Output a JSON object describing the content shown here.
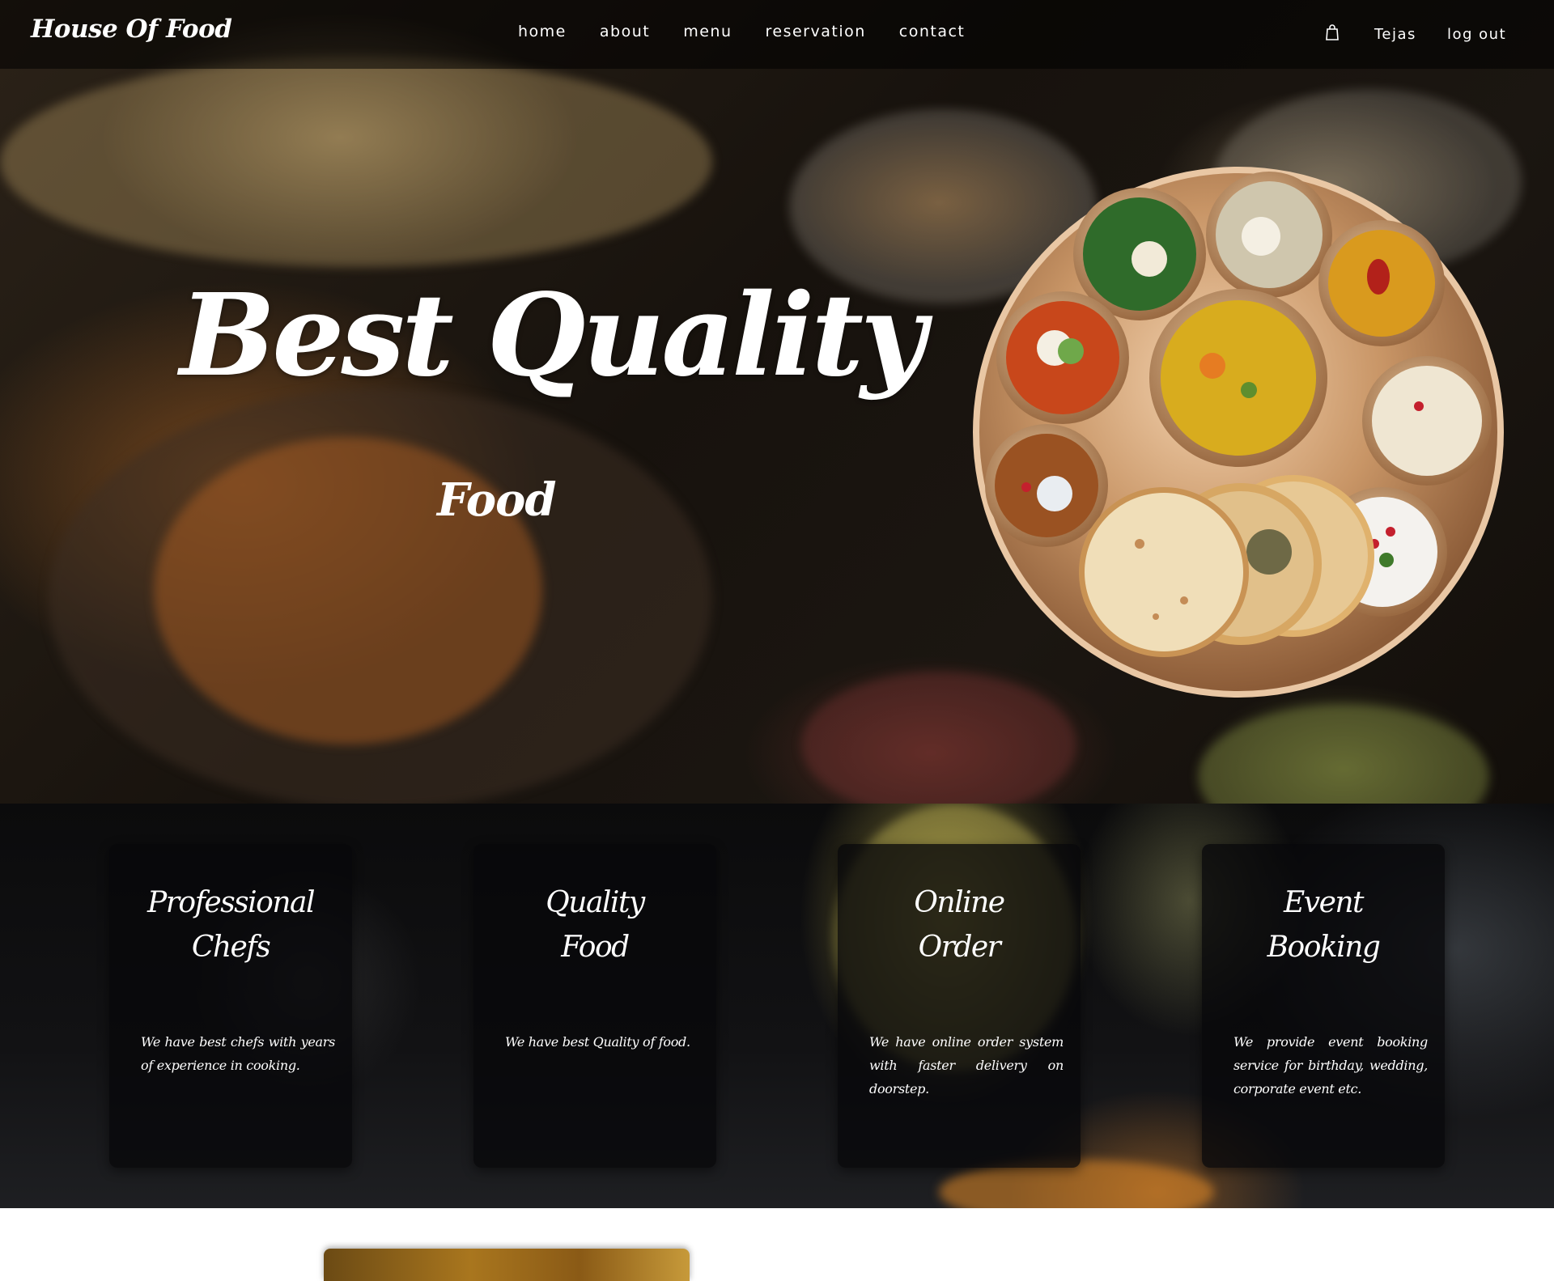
{
  "brand": "House Of Food",
  "nav": {
    "links": [
      "home",
      "about",
      "menu",
      "reservation",
      "contact"
    ],
    "cart_icon": "shopping-bag-icon",
    "user": "Tejas",
    "logout": "log out"
  },
  "hero": {
    "title": "Best Quality",
    "subtitle": "Food"
  },
  "features": [
    {
      "title_lines": [
        "Professional",
        "Chefs"
      ],
      "text": "We have best chefs with years of experience in cooking."
    },
    {
      "title_lines": [
        "Quality",
        "Food"
      ],
      "text": "We have best Quality of food."
    },
    {
      "title_lines": [
        "Online",
        "Order"
      ],
      "text": "We have online order system with faster delivery on doorstep."
    },
    {
      "title_lines": [
        "Event",
        "Booking"
      ],
      "text": "We provide event booking service for birthday, wedding, corporate event etc."
    }
  ],
  "colors": {
    "text": "#ffffff",
    "nav_bg": "rgba(0,0,0,0.55)",
    "card_bg": "rgba(8,8,10,0.78)",
    "plate": "#c08a5a"
  }
}
